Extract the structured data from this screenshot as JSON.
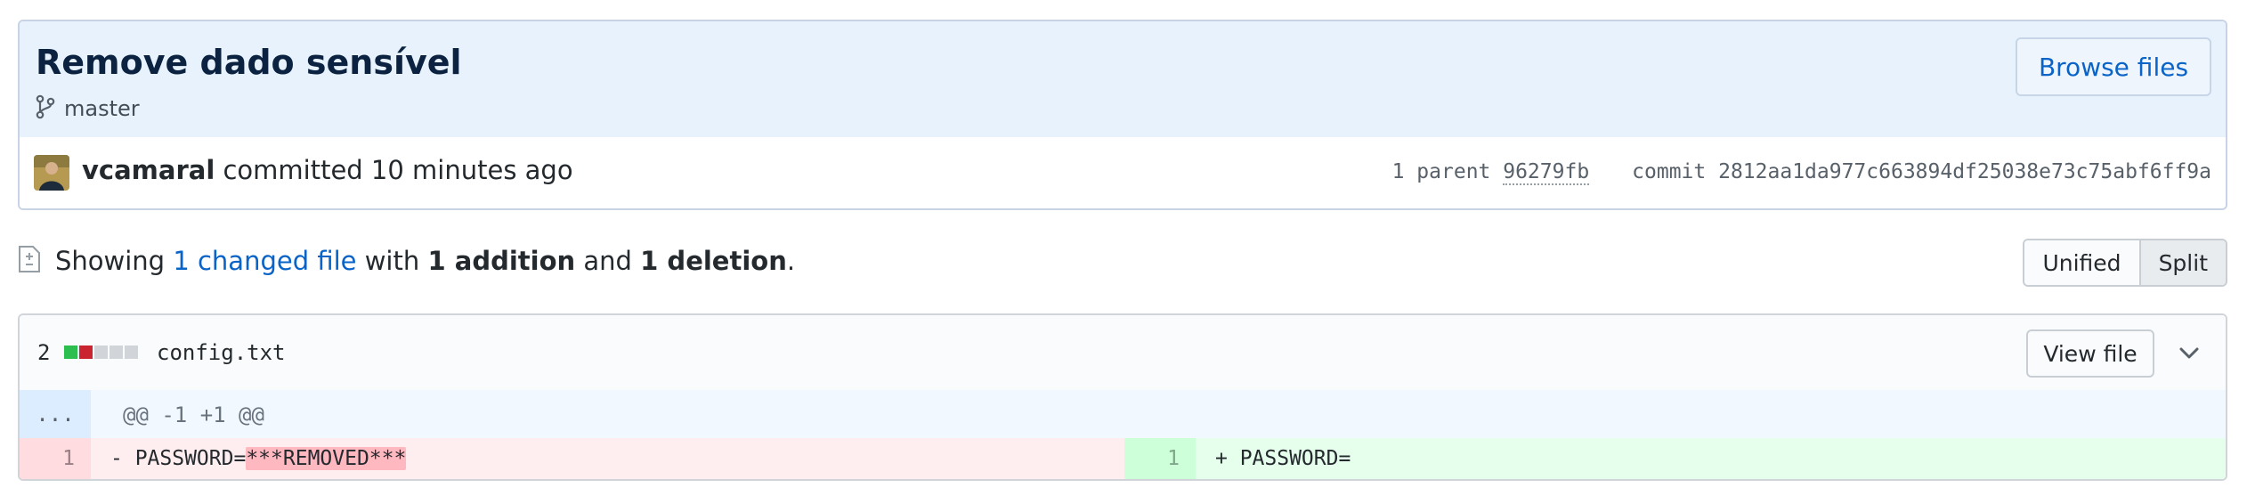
{
  "commit": {
    "title": "Remove dado sensível",
    "branch": "master",
    "browse_label": "Browse files",
    "author": "vcamaral",
    "action": " committed 10 minutes ago",
    "parent_label": "1 parent ",
    "parent_sha": "96279fb",
    "commit_label": "commit ",
    "commit_sha": "2812aa1da977c663894df25038e73c75abf6ff9a"
  },
  "summary": {
    "prefix": "Showing ",
    "changed": "1 changed file",
    "with": " with ",
    "additions": "1 addition",
    "and": " and ",
    "deletions": "1 deletion",
    "end": "."
  },
  "view_toggle": {
    "unified": "Unified",
    "split": "Split",
    "selected": "Split"
  },
  "file": {
    "changes": "2",
    "name": "config.txt",
    "view_file_label": "View file",
    "diffstat": [
      "added",
      "deleted",
      "neutral",
      "neutral",
      "neutral"
    ],
    "hunk_expand": "...",
    "hunk_header": "@@ -1 +1 @@",
    "left": {
      "line_no": "1",
      "prefix": "- PASSWORD=",
      "highlight": "***REMOVED***"
    },
    "right": {
      "line_no": "1",
      "text": "+ PASSWORD="
    }
  },
  "colors": {
    "link": "#0a63c7",
    "added": "#2cbe4e",
    "deleted": "#cb2431",
    "neutral": "#d1d5da"
  },
  "icons": [
    "git-branch-icon",
    "avatar",
    "file-diff-icon",
    "chevron-down-icon"
  ]
}
